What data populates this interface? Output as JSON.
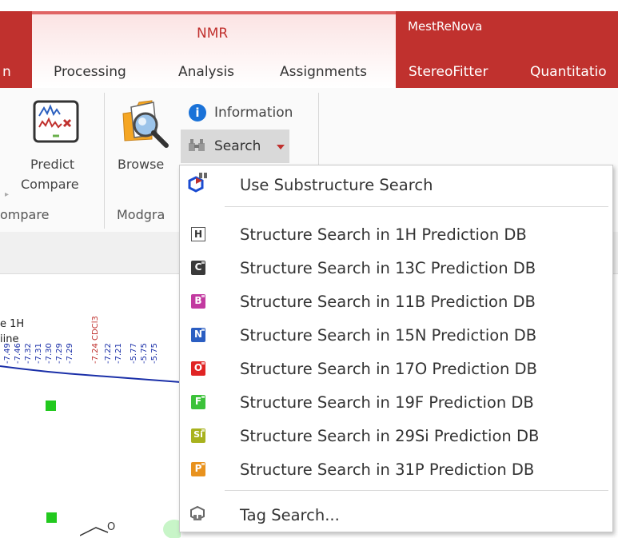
{
  "ribbon": {
    "context_nmr": "NMR",
    "context_mest": "MestReNova",
    "tabs": {
      "partial": "n",
      "processing": "Processing",
      "analysis": "Analysis",
      "assignments": "Assignments",
      "stereofitter": "StereoFitter",
      "quantitation": "Quantitatio"
    },
    "predict_label": "Predict",
    "compare_label": "Compare",
    "compare_group": "ompare",
    "browse_label": "Browse",
    "modgraph_group": "Modgra",
    "information_label": "Information",
    "search_label": "Search"
  },
  "document": {
    "label_1": "e 1H",
    "label_2": "iine",
    "solvent": "-7.24 CDCl3",
    "peaks_left": [
      "-7.49",
      "-7.46",
      "-7.32",
      "-7.31",
      "-7.30",
      "-7.29",
      "-7.29"
    ],
    "peaks_right": [
      "-7.22",
      "-7.21",
      "-5.77",
      "-5.75",
      "-5.75"
    ],
    "molecule_atom": "O"
  },
  "menu": {
    "use_substructure": "Use Substructure Search",
    "db_items": [
      {
        "label": "Structure Search in 1H Prediction DB",
        "badge": "H",
        "color": "#ffffff"
      },
      {
        "label": "Structure Search in 13C Prediction DB",
        "badge": "C",
        "color": "#3a3a3a"
      },
      {
        "label": "Structure Search in 11B Prediction DB",
        "badge": "B",
        "color": "#c23aa0"
      },
      {
        "label": "Structure Search in 15N Prediction DB",
        "badge": "N",
        "color": "#2b5ec2"
      },
      {
        "label": "Structure Search in 17O Prediction DB",
        "badge": "O",
        "color": "#e02424"
      },
      {
        "label": "Structure Search in 19F Prediction DB",
        "badge": "F",
        "color": "#3cc23a"
      },
      {
        "label": "Structure Search in 29Si Prediction DB",
        "badge": "Si",
        "color": "#a8b21e"
      },
      {
        "label": "Structure Search in 31P Prediction DB",
        "badge": "P",
        "color": "#e8921e"
      }
    ],
    "tag_search": "Tag Search..."
  }
}
